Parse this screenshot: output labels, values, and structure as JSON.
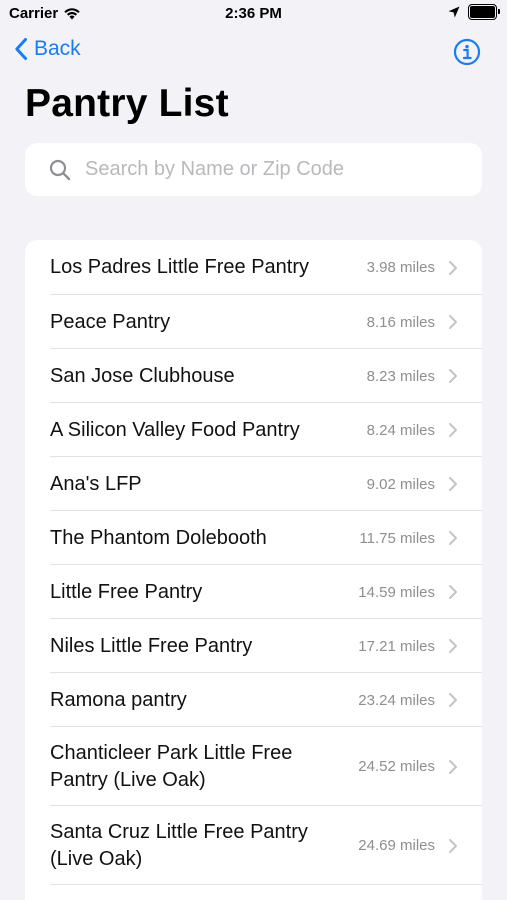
{
  "status_bar": {
    "carrier": "Carrier",
    "time": "2:36 PM",
    "battery_level": 1.0
  },
  "nav": {
    "back_label": "Back",
    "info_icon": "info-circle-icon",
    "accent_color": "#1a7cf5"
  },
  "page": {
    "title": "Pantry List"
  },
  "search": {
    "placeholder": "Search by Name or Zip Code",
    "value": ""
  },
  "pantries": [
    {
      "name": "Los Padres Little Free Pantry",
      "distance": "3.98 miles"
    },
    {
      "name": "Peace Pantry",
      "distance": "8.16 miles"
    },
    {
      "name": "San Jose Clubhouse",
      "distance": "8.23 miles"
    },
    {
      "name": "A Silicon Valley Food Pantry",
      "distance": "8.24 miles"
    },
    {
      "name": "Ana's LFP",
      "distance": "9.02 miles"
    },
    {
      "name": "The Phantom Dolebooth",
      "distance": "11.75 miles"
    },
    {
      "name": "Little Free Pantry",
      "distance": "14.59 miles"
    },
    {
      "name": "Niles Little Free Pantry",
      "distance": "17.21 miles"
    },
    {
      "name": "Ramona pantry",
      "distance": "23.24 miles"
    },
    {
      "name": "Chanticleer Park Little Free Pantry (Live Oak)",
      "distance": "24.52 miles"
    },
    {
      "name": "Santa Cruz Little Free Pantry (Live Oak)",
      "distance": "24.69 miles"
    }
  ]
}
